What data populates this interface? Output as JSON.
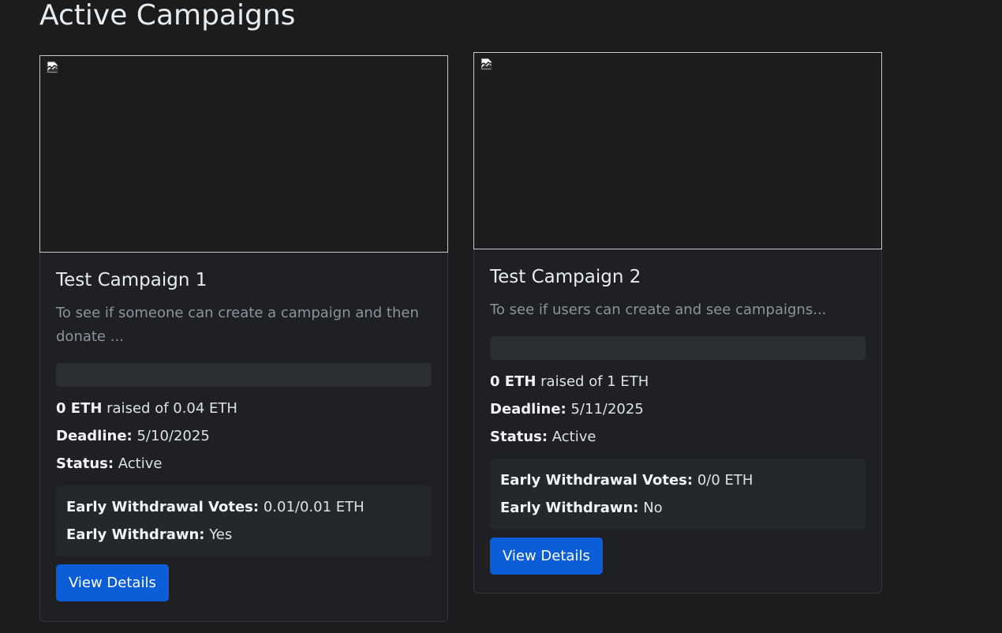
{
  "page": {
    "title": "Active Campaigns"
  },
  "campaigns": [
    {
      "title": "Test Campaign 1",
      "description": "To see if someone can create a campaign and then donate ...",
      "raised": "0 ETH",
      "raised_suffix": " raised of 0.04 ETH",
      "progress_percent": 0,
      "deadline_label": "Deadline:",
      "deadline": " 5/10/2025",
      "status_label": "Status:",
      "status": " Active",
      "votes_label": "Early Withdrawal Votes:",
      "votes": " 0.01/0.01 ETH",
      "withdrawn_label": "Early Withdrawn:",
      "withdrawn": " Yes",
      "button_label": "View Details"
    },
    {
      "title": "Test Campaign 2",
      "description": "To see if users can create and see campaigns...",
      "raised": "0 ETH",
      "raised_suffix": " raised of 1 ETH",
      "progress_percent": 0,
      "deadline_label": "Deadline:",
      "deadline": " 5/11/2025",
      "status_label": "Status:",
      "status": " Active",
      "votes_label": "Early Withdrawal Votes:",
      "votes": " 0/0 ETH",
      "withdrawn_label": "Early Withdrawn:",
      "withdrawn": " No",
      "button_label": "View Details"
    }
  ],
  "colors": {
    "background": "#1a1c1e",
    "card": "#1e2023",
    "accent_button": "#0b5ed7",
    "progress_track": "#2b2f33"
  },
  "icons": {
    "image_placeholder": "broken-image-icon"
  }
}
